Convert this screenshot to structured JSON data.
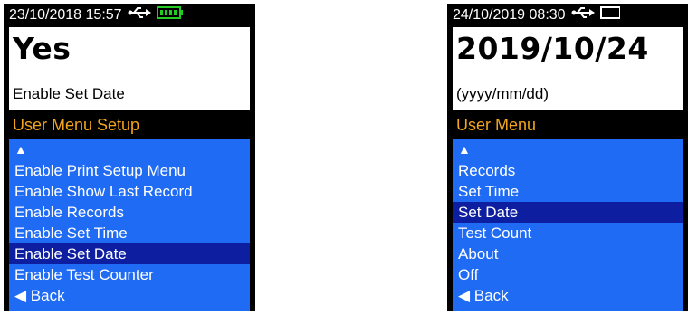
{
  "left": {
    "status": {
      "datetime": "23/10/2018  15:57"
    },
    "value": "Yes",
    "subtitle": "Enable Set Date",
    "menu_title": "User Menu Setup",
    "items": [
      {
        "label": "▲"
      },
      {
        "label": "Enable Print Setup Menu"
      },
      {
        "label": "Enable Show Last Record"
      },
      {
        "label": "Enable Records"
      },
      {
        "label": "Enable Set Time"
      },
      {
        "label": "Enable Set Date"
      },
      {
        "label": "Enable Test Counter"
      },
      {
        "label": "◀ Back"
      }
    ]
  },
  "right": {
    "status": {
      "datetime": "24/10/2019 08:30"
    },
    "value": "2019/10/24",
    "subtitle": "(yyyy/mm/dd)",
    "menu_title": "User Menu",
    "items": [
      {
        "label": "▲"
      },
      {
        "label": "Records"
      },
      {
        "label": "Set Time"
      },
      {
        "label": "Set Date"
      },
      {
        "label": "Test Count"
      },
      {
        "label": "About"
      },
      {
        "label": "Off"
      },
      {
        "label": "◀ Back"
      }
    ]
  },
  "colors": {
    "accent": "#f2a41e",
    "menu_bg": "#1f6bf4",
    "selected_bg": "#0d1fa0",
    "battery": "#22cc22"
  },
  "icons": {
    "usb": "usb-icon",
    "battery": "battery-icon"
  }
}
